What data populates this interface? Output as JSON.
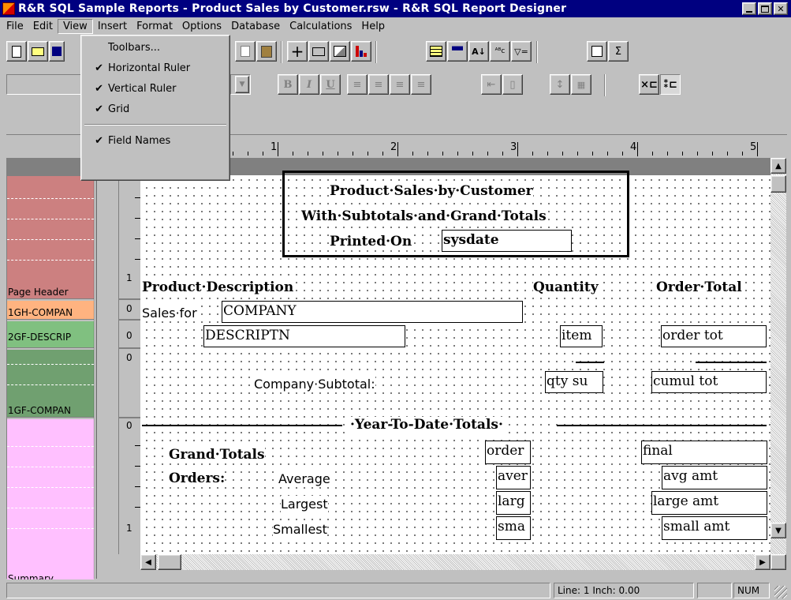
{
  "window": {
    "title": "R&R SQL Sample Reports - Product Sales by Customer.rsw - R&R SQL Report Designer"
  },
  "menubar": [
    "File",
    "Edit",
    "View",
    "Insert",
    "Format",
    "Options",
    "Database",
    "Calculations",
    "Help"
  ],
  "view_menu": {
    "items": [
      {
        "label": "Toolbars...",
        "checked": false
      },
      {
        "label": "Horizontal Ruler",
        "checked": true
      },
      {
        "label": "Vertical Ruler",
        "checked": true
      },
      {
        "label": "Grid",
        "checked": true
      },
      {
        "label": "Field Names",
        "checked": true
      }
    ],
    "checkmark": "✔"
  },
  "toolbar": {
    "sigma": "Σ",
    "bold": "B",
    "italic": "I",
    "underline": "U"
  },
  "ruler": [
    "1",
    "2",
    "3",
    "4",
    "5"
  ],
  "vruler": [
    "1",
    "0",
    "0",
    "0",
    "0",
    "1"
  ],
  "sections": [
    {
      "label": "Page Header",
      "color": "#cc8080"
    },
    {
      "label": "1GH-COMPAN",
      "color": "#ffb380"
    },
    {
      "label": "2GF-DESCRIP",
      "color": "#80c080"
    },
    {
      "label": "1GF-COMPAN",
      "color": "#70a070"
    },
    {
      "label": "Summary",
      "color": "#ffc0ff"
    }
  ],
  "report": {
    "title_line1": "Product·Sales·by·Customer",
    "title_line2": "With·Subtotals·and·Grand·Totals",
    "printed_on": "Printed·On",
    "sysdate": "sysdate",
    "col_product": "Product·Description",
    "col_quantity": "Quantity",
    "col_order_total": "Order·Total",
    "sales_for": "Sales·for",
    "company": "COMPANY",
    "descriptn": "DESCRIPTN",
    "item": "item",
    "order_tot": "order tot",
    "company_subtotal": "Company·Subtotal:",
    "qty_su": "qty su",
    "cumul_tot": "cumul tot",
    "ytd": "·Year-To-Date·Totals·",
    "grand_totals": "Grand·Totals",
    "order": "order",
    "final": "final",
    "orders": "Orders:",
    "average": "Average",
    "aver": "aver",
    "avg_amt": "avg amt",
    "largest": "Largest",
    "larg": "larg",
    "large_amt": "large amt",
    "smallest": "Smallest",
    "sma": "sma",
    "small_amt": "small amt"
  },
  "status": {
    "line": "Line:  1  Inch: 0.00",
    "num": "NUM"
  }
}
